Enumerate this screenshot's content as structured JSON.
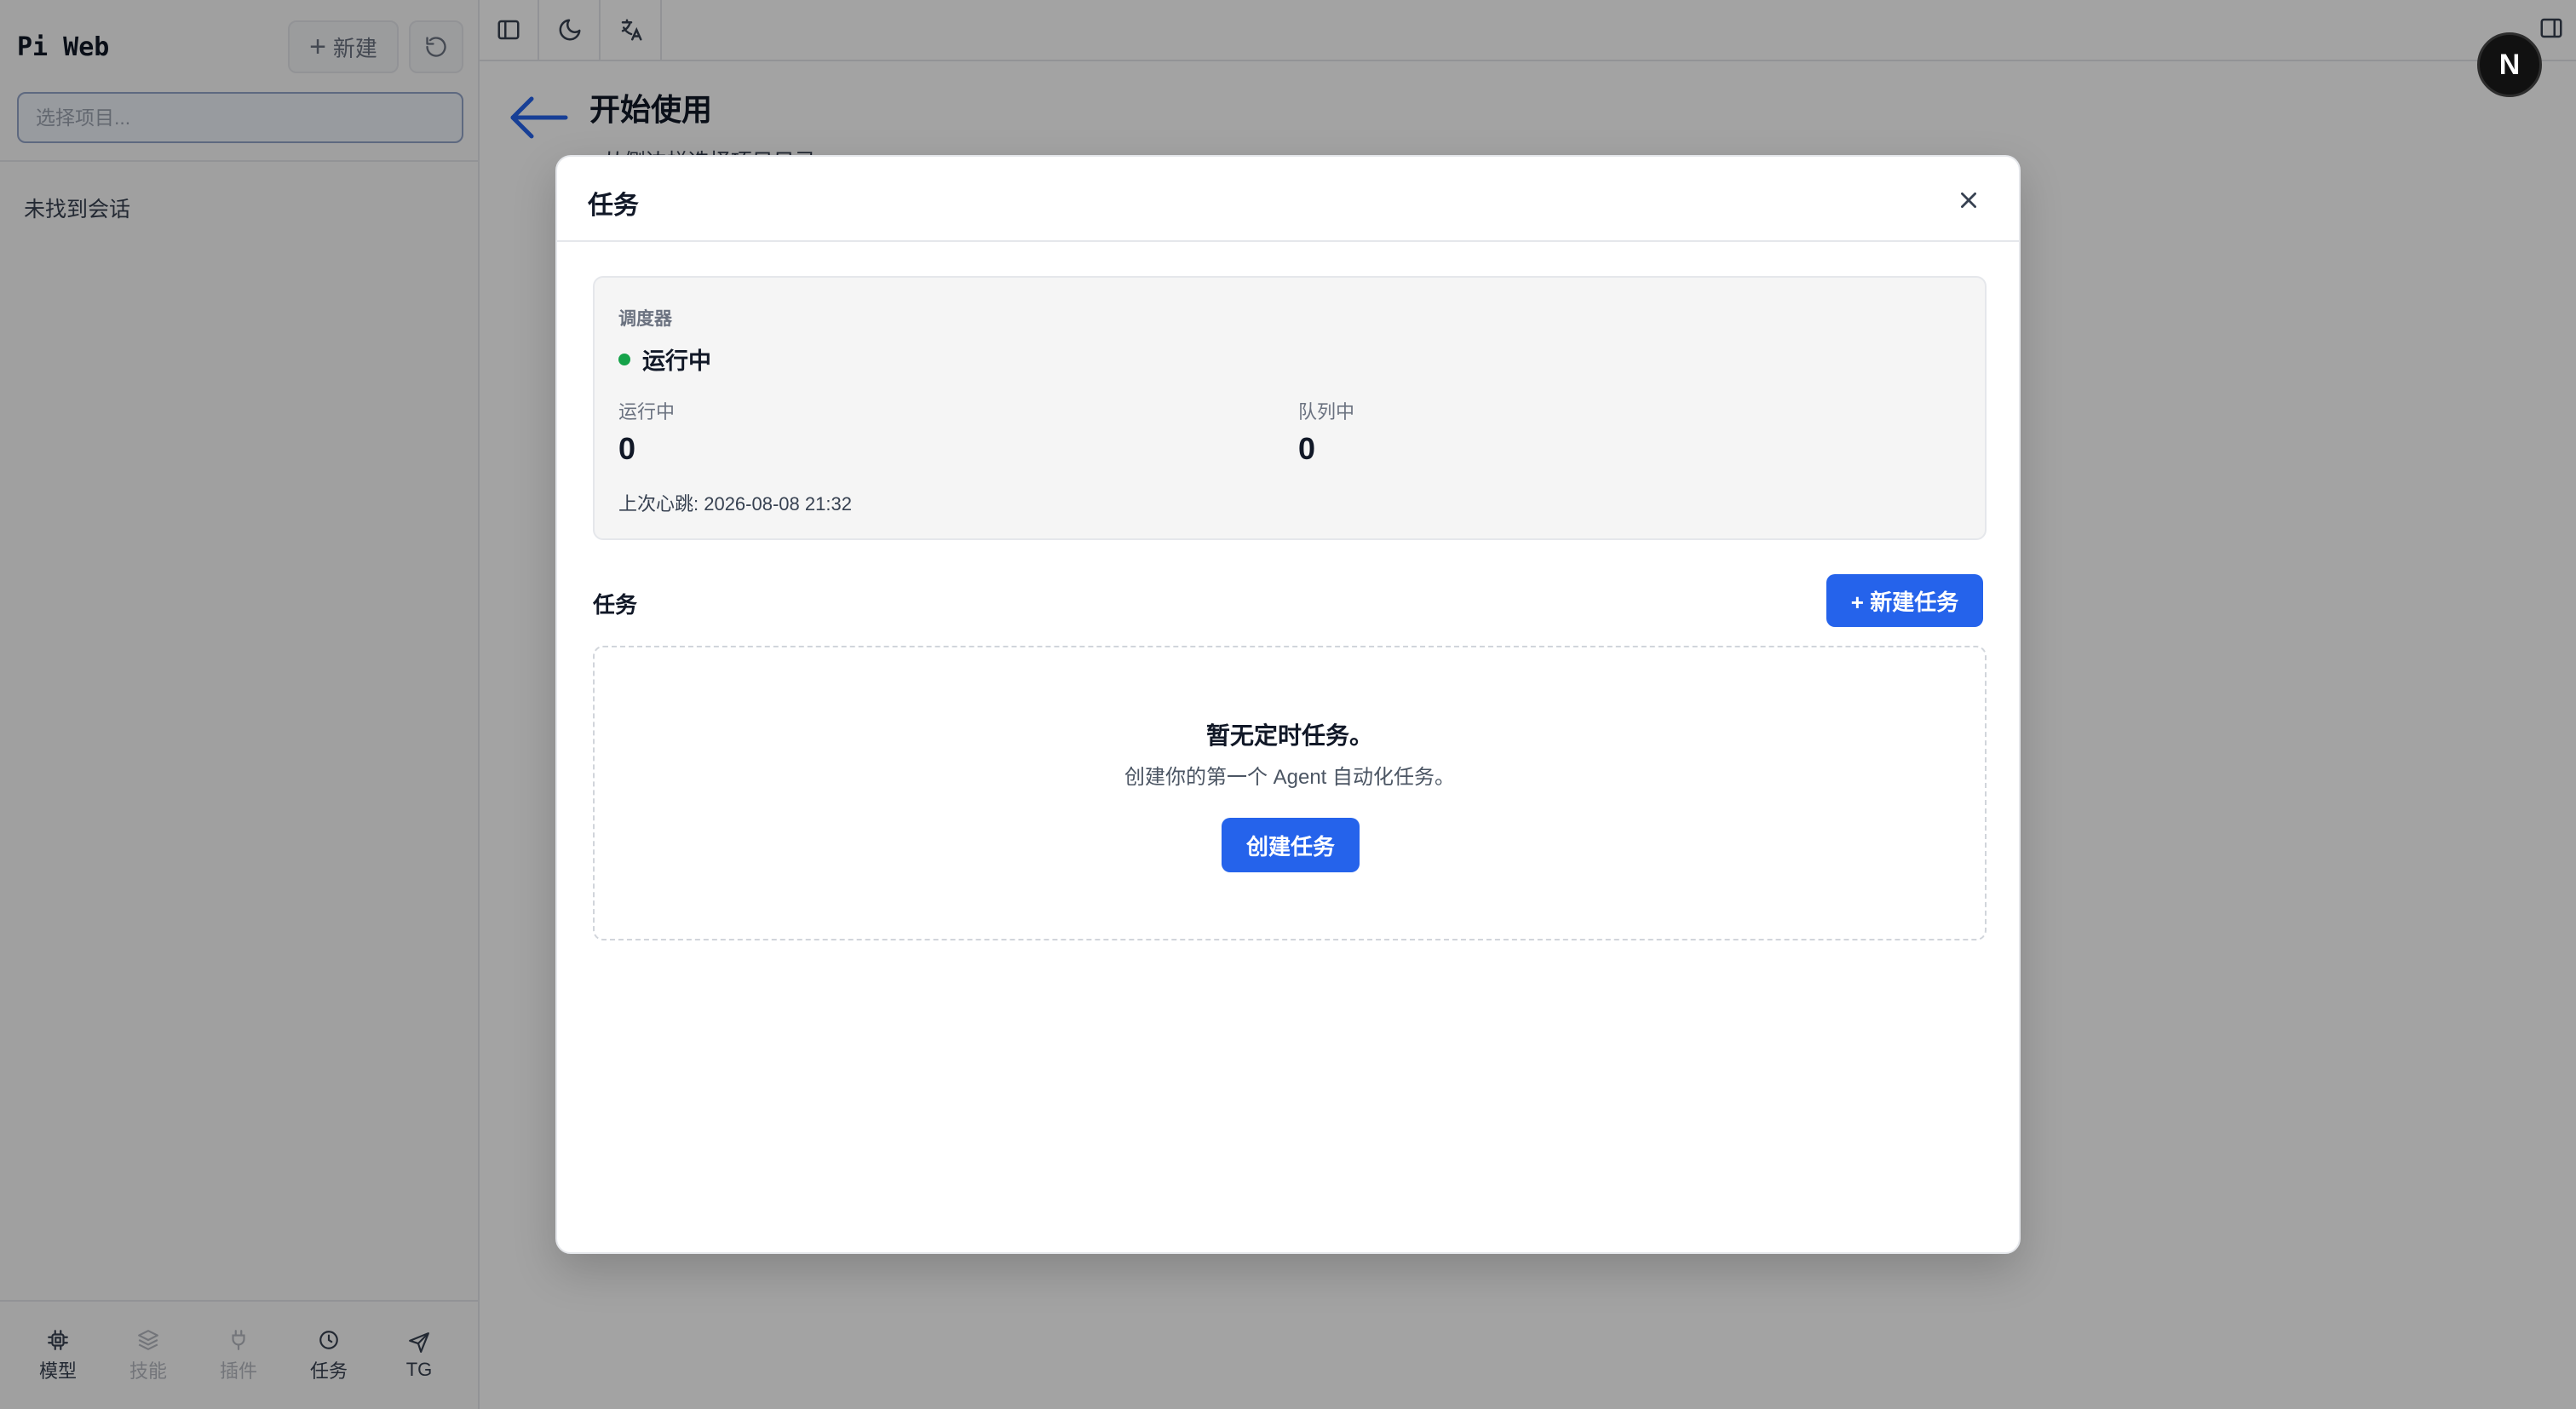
{
  "sidebar": {
    "app_title": "Pi Web",
    "new_button_label": "新建",
    "project_placeholder": "选择项目...",
    "empty_sessions": "未找到会话",
    "tabs": [
      {
        "icon": "cpu-icon",
        "label": "模型",
        "enabled": true
      },
      {
        "icon": "layers-icon",
        "label": "技能",
        "enabled": false
      },
      {
        "icon": "plug-icon",
        "label": "插件",
        "enabled": false
      },
      {
        "icon": "clock-icon",
        "label": "任务",
        "enabled": true
      },
      {
        "icon": "send-icon",
        "label": "TG",
        "enabled": true
      }
    ]
  },
  "topbar": {
    "buttons": [
      "sidebar-toggle-icon",
      "moon-icon",
      "translate-icon"
    ],
    "right_button": "panel-right-icon"
  },
  "avatar": {
    "letter": "N"
  },
  "main": {
    "title": "开始使用",
    "hint": "• 从侧边栏选择项目目录"
  },
  "modal": {
    "title": "任务",
    "scheduler": {
      "label": "调度器",
      "status": "运行中",
      "status_color": "#16a34a",
      "running_label": "运行中",
      "running_value": "0",
      "queued_label": "队列中",
      "queued_value": "0",
      "heartbeat": "上次心跳: 2026-08-08 21:32"
    },
    "tasks_title": "任务",
    "new_task_button": "+ 新建任务",
    "empty_title": "暂无定时任务。",
    "empty_desc": "创建你的第一个 Agent 自动化任务。",
    "create_task_button": "创建任务"
  },
  "colors": {
    "accent": "#2563eb",
    "status_running": "#16a34a"
  }
}
